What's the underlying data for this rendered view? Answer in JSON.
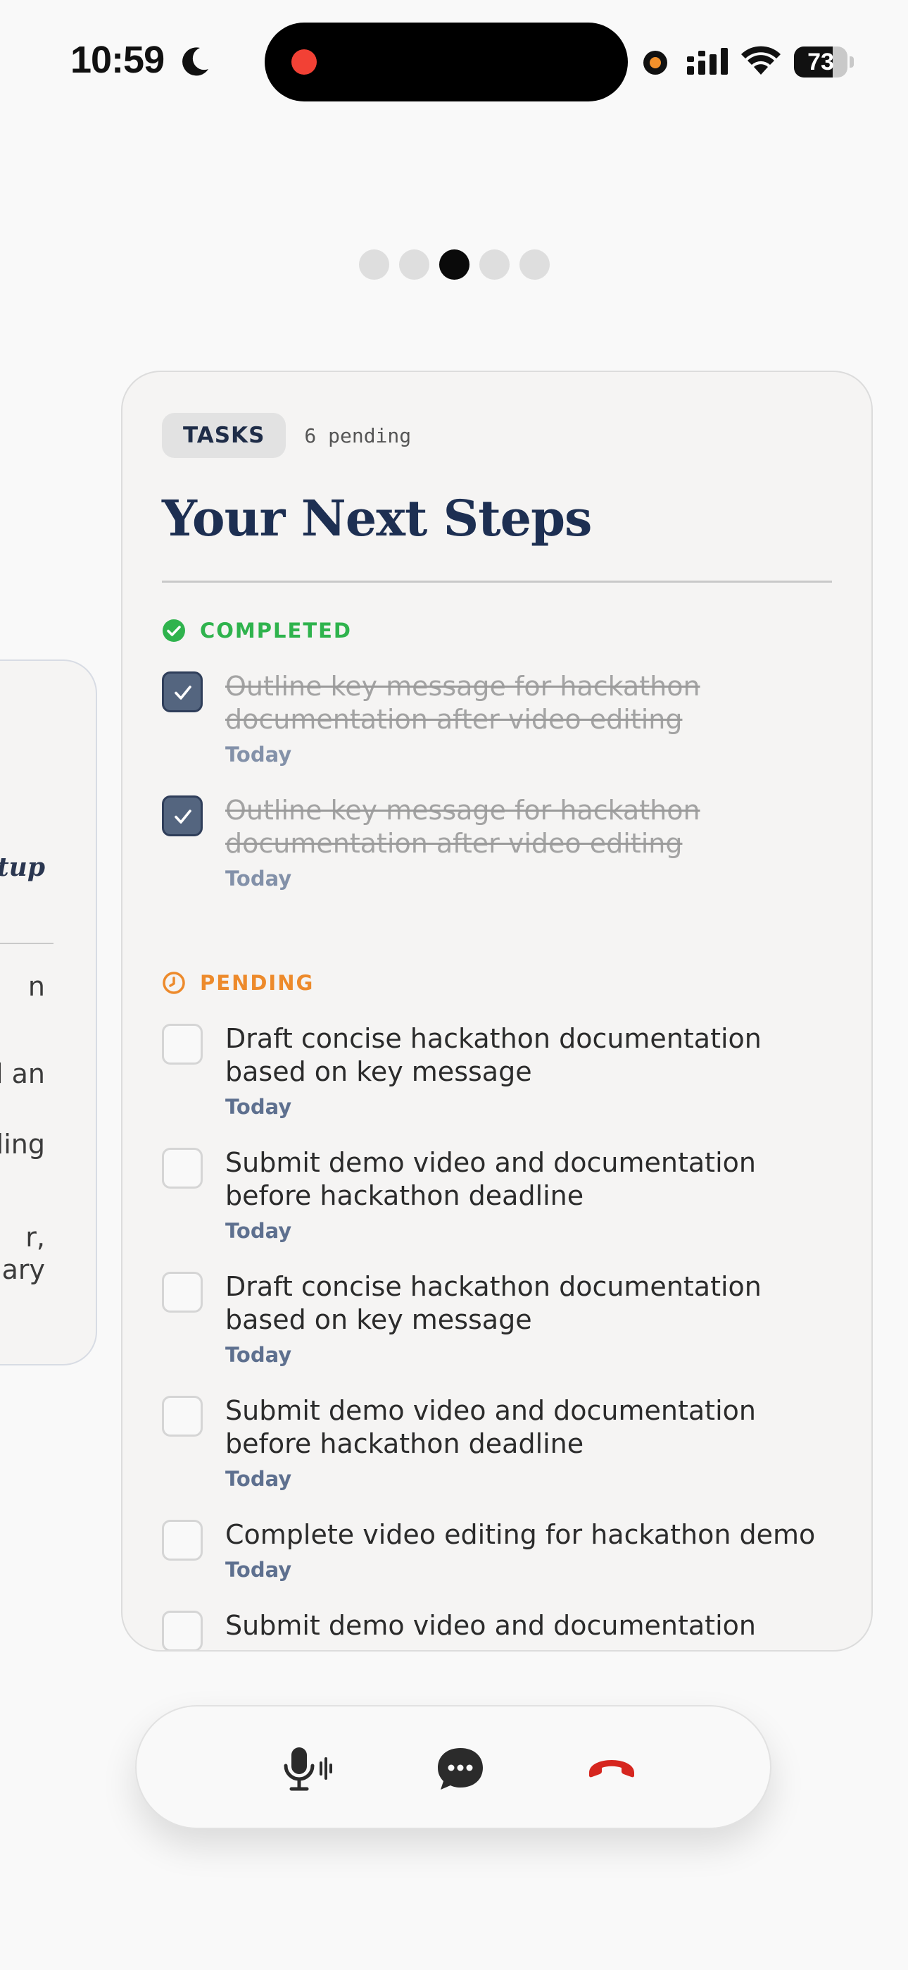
{
  "status_bar": {
    "time": "10:59",
    "battery": "73",
    "battery_level": 0.73,
    "icons": [
      "moon-icon",
      "signal-icon",
      "wifi-icon",
      "battery-icon"
    ]
  },
  "pager": {
    "count": 5,
    "active_index": 2
  },
  "peek_card": {
    "heading_fragment": "tup",
    "lines": [
      "n",
      "d an",
      "ling",
      "r,",
      "nary"
    ]
  },
  "card": {
    "badge": "TASKS",
    "pending_count": "6 pending",
    "title": "Your Next Steps",
    "completed_label": "COMPLETED",
    "pending_label": "PENDING",
    "completed_tasks": [
      {
        "text": "Outline key message for hackathon documentation after video editing",
        "date": "Today"
      },
      {
        "text": "Outline key message for hackathon documentation after video editing",
        "date": "Today"
      }
    ],
    "pending_tasks": [
      {
        "text": "Draft concise hackathon documentation based on key message",
        "date": "Today"
      },
      {
        "text": "Submit demo video and documentation before hackathon deadline",
        "date": "Today"
      },
      {
        "text": "Draft concise hackathon documentation based on key message",
        "date": "Today"
      },
      {
        "text": "Submit demo video and documentation before hackathon deadline",
        "date": "Today"
      },
      {
        "text": "Complete video editing for hackathon demo",
        "date": "Today"
      },
      {
        "text": "Submit demo video and documentation",
        "date": ""
      }
    ]
  },
  "call_bar": {
    "buttons": [
      "microphone-icon",
      "chat-bubble-icon",
      "end-call-icon"
    ],
    "colors": {
      "end_call": "#d6261f",
      "icons": "#2b2b2b"
    }
  },
  "colors": {
    "completed": "#2fb34d",
    "pending": "#ed8a2b",
    "title": "#1d2f52",
    "checked_box": "#54657f"
  }
}
